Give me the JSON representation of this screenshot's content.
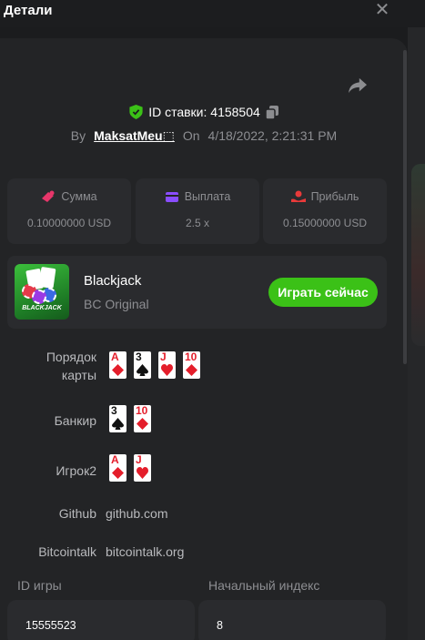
{
  "header": {
    "title": "Детали",
    "close_icon": "close-icon"
  },
  "bet": {
    "id_label": "ID ставки: 4158504",
    "by_label": "By",
    "username": "MaksatMeu⬚",
    "on_label": "On",
    "datetime": "4/18/2022, 2:21:31 PM"
  },
  "stats": [
    {
      "label": "Сумма",
      "value": "0.10000000 USD",
      "icon": "money-icon",
      "color": "#e8366a"
    },
    {
      "label": "Выплата",
      "value": "2.5 x",
      "icon": "wallet-icon",
      "color": "#8a4dff"
    },
    {
      "label": "Прибыль",
      "value": "0.15000000 USD",
      "icon": "profit-icon",
      "color": "#e83a3a"
    }
  ],
  "game": {
    "thumb_label": "BLACKJACK",
    "name": "Blackjack",
    "provider": "BC Original",
    "play_label": "Играть сейчас"
  },
  "rows": {
    "order_label_1": "Порядок",
    "order_label_2": "карты",
    "order_cards": [
      {
        "rank": "A",
        "suit": "diamond"
      },
      {
        "rank": "3",
        "suit": "spade"
      },
      {
        "rank": "J",
        "suit": "heart"
      },
      {
        "rank": "10",
        "suit": "diamond"
      }
    ],
    "banker_label": "Банкир",
    "banker_cards": [
      {
        "rank": "3",
        "suit": "spade"
      },
      {
        "rank": "10",
        "suit": "diamond"
      }
    ],
    "player_label": "Игрок2",
    "player_cards": [
      {
        "rank": "A",
        "suit": "diamond"
      },
      {
        "rank": "J",
        "suit": "heart"
      }
    ]
  },
  "links": {
    "github_label": "Github",
    "github_value": "github.com",
    "bitcointalk_label": "Bitcointalk",
    "bitcointalk_value": "bitcointalk.org"
  },
  "fields": {
    "game_id_label": "ID игры",
    "game_id_value": "15555523",
    "start_index_label": "Начальный индекс",
    "start_index_value": "8"
  },
  "colors": {
    "accent_green": "#3bc117",
    "background": "#1b1c1e",
    "card_red": "#e41e2b"
  }
}
